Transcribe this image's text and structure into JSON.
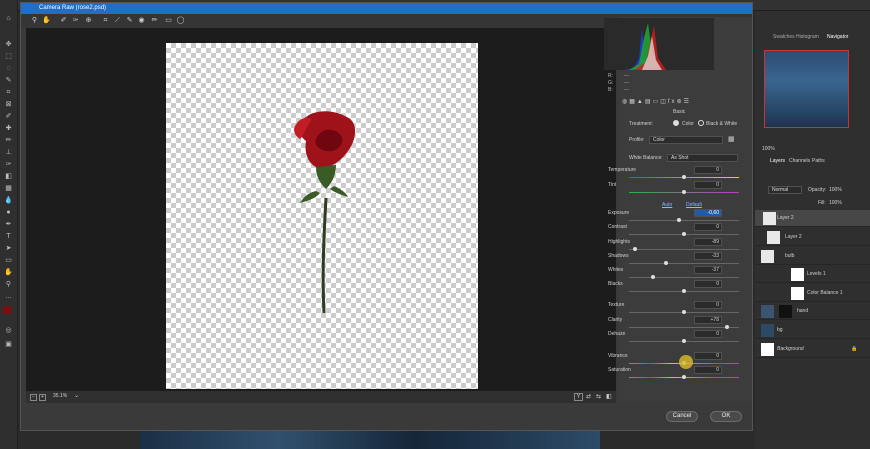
{
  "dialog": {
    "title": "Camera Raw (rose2.psd)",
    "cancel_label": "Cancel",
    "ok_label": "OK"
  },
  "toolbar": {
    "icons": [
      "zoom-icon",
      "hand-icon",
      "white-balance-icon",
      "color-sampler-icon",
      "target-adjust-icon",
      "crop-icon",
      "straighten-icon",
      "spot-removal-icon",
      "red-eye-icon",
      "adjustment-brush-icon",
      "graduated-filter-icon",
      "radial-filter-icon"
    ]
  },
  "canvas_bottom": {
    "zoom": "35.1%"
  },
  "histogram": {
    "r_label": "R:",
    "g_label": "G:",
    "b_label": "B:",
    "r_value": "---",
    "g_value": "---",
    "b_value": "---"
  },
  "panel": {
    "section_title": "Basic",
    "treatment_label": "Treatment:",
    "treatment_color": "Color",
    "treatment_bw": "Black & White",
    "profile_label": "Profile:",
    "profile_value": "Color",
    "wb_label": "White Balance:",
    "wb_value": "As Shot",
    "auto_label": "Auto",
    "default_label": "Default",
    "temperature": {
      "label": "Temperature",
      "value": "0"
    },
    "tint": {
      "label": "Tint",
      "value": "0"
    },
    "sliders": [
      {
        "label": "Exposure",
        "value": "-0,60"
      },
      {
        "label": "Contrast",
        "value": "0"
      },
      {
        "label": "Highlights",
        "value": "-89"
      },
      {
        "label": "Shadows",
        "value": "-33"
      },
      {
        "label": "Whites",
        "value": "-37"
      },
      {
        "label": "Blacks",
        "value": "0"
      },
      {
        "label": "Texture",
        "value": "0"
      },
      {
        "label": "Clarity",
        "value": "+78"
      },
      {
        "label": "Dehaze",
        "value": "0"
      },
      {
        "label": "Vibrance",
        "value": "0"
      },
      {
        "label": "Saturation",
        "value": "0"
      }
    ]
  },
  "ps_panels": {
    "tabs": [
      "Swatches",
      "Histogram",
      "Navigator"
    ],
    "zoom": "100%",
    "layers_tabs": [
      "Layers",
      "Channels",
      "Paths"
    ],
    "blend_mode": "Normal",
    "opacity_label": "Opacity:",
    "opacity_value": "100%",
    "fill_label": "Fill:",
    "fill_value": "100%",
    "layers": [
      "Layer 2",
      "Layer 2",
      "bulb",
      "Levels 1",
      "Color Balance 1",
      "hand",
      "bg",
      "Background"
    ]
  }
}
